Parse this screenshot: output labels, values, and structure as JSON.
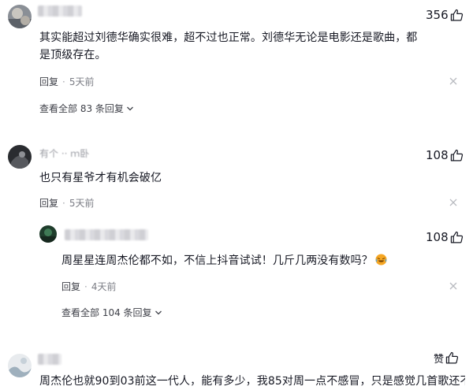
{
  "comments": [
    {
      "id": "c1",
      "username": "",
      "like_count": "356",
      "text": "其实能超过刘德华确实很难，超不过也正常。刘德华无论是电影还是歌曲，都是顶级存在。",
      "reply_label": "回复",
      "time": "5天前",
      "expand_label": "查看全部 83 条回复"
    },
    {
      "id": "c2",
      "username": "有个  ··  ｍ卧",
      "like_count": "108",
      "text": "也只有星爷才有机会破亿",
      "reply_label": "回复",
      "time": "5天前",
      "replies": [
        {
          "id": "c2r1",
          "username": "",
          "like_count": "108",
          "text": "周星星连周杰伦都不如，不信上抖音试试！几斤几两没有数吗？",
          "emoji": "laugh-cry-emoji",
          "reply_label": "回复",
          "time": "4天前",
          "expand_label": "查看全部 104 条回复"
        }
      ]
    },
    {
      "id": "c3",
      "username": "",
      "like_label": "赞",
      "text": "周杰伦也就90到03前这一代人，能有多少，我85对周一点不感冒，只是感觉几首歌还不"
    }
  ],
  "icons": {
    "like": "thumb-up-icon",
    "close": "close-icon",
    "expand": "chevron-down-icon"
  },
  "colors": {
    "text": "#161823",
    "secondary": "#7b7d85",
    "username": "#9a9ca3",
    "emoji": "#f5a623"
  }
}
